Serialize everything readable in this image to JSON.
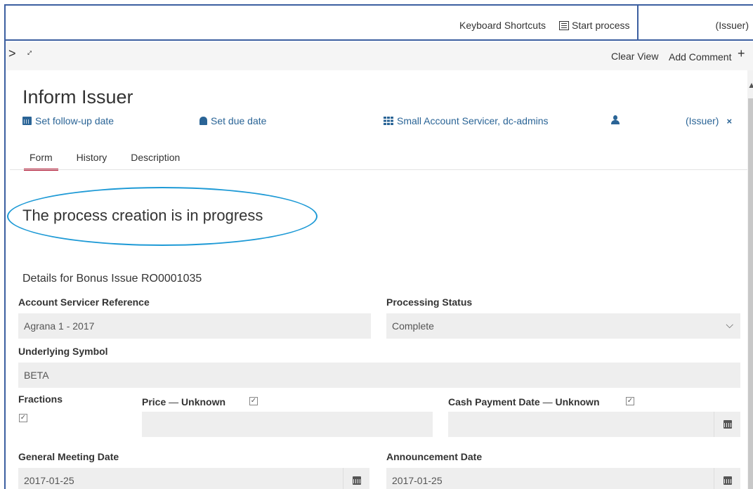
{
  "topbar": {
    "keyboard_shortcuts": "Keyboard Shortcuts",
    "start_process": "Start process",
    "issuer": "(Issuer)"
  },
  "toolbar": {
    "clear_view": "Clear View",
    "add_comment": "Add Comment",
    "plus": "+"
  },
  "task": {
    "title": "Inform Issuer",
    "follow_up": "Set follow-up date",
    "due_date": "Set due date",
    "groups": "Small Account Servicer, dc-admins",
    "assignee": "(Issuer)",
    "remove_assignee": "×"
  },
  "tabs": [
    "Form",
    "History",
    "Description"
  ],
  "message": "The process creation is in progress",
  "details_title": "Details for Bonus Issue RO0001035",
  "form": {
    "account_servicer_ref_label": "Account Servicer Reference",
    "account_servicer_ref_value": "Agrana 1 - 2017",
    "processing_status_label": "Processing Status",
    "processing_status_value": "Complete",
    "underlying_symbol_label": "Underlying Symbol",
    "underlying_symbol_value": "BETA",
    "fractions_label": "Fractions",
    "price_label": "Price",
    "dash": "—",
    "unknown_label": "Unknown",
    "cash_payment_label": "Cash Payment Date",
    "general_meeting_label": "General Meeting Date",
    "general_meeting_value": "2017-01-25",
    "announcement_label": "Announcement Date",
    "announcement_value": "2017-01-25"
  }
}
